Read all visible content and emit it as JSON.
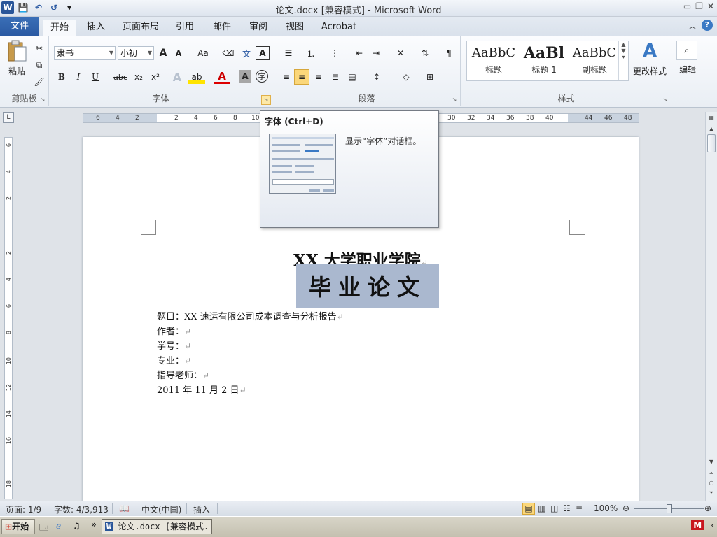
{
  "window": {
    "title": "论文.docx [兼容模式] - Microsoft Word",
    "app_icon_letter": "W"
  },
  "qat": {
    "save": "💾",
    "undo": "↶",
    "redo": "↺",
    "more": "▾"
  },
  "tabs": [
    {
      "label": "文件"
    },
    {
      "label": "开始"
    },
    {
      "label": "插入"
    },
    {
      "label": "页面布局"
    },
    {
      "label": "引用"
    },
    {
      "label": "邮件"
    },
    {
      "label": "审阅"
    },
    {
      "label": "视图"
    },
    {
      "label": "Acrobat"
    }
  ],
  "ribbon": {
    "clipboard": {
      "label": "剪贴板",
      "paste": "粘贴"
    },
    "font": {
      "label": "字体",
      "font_name": "隶书",
      "font_size": "小初",
      "grow": "A",
      "shrink": "A",
      "change_case": "Aa",
      "bold": "B",
      "italic": "I",
      "underline": "U",
      "strike": "abc",
      "subscript": "x₂",
      "superscript": "x²"
    },
    "paragraph": {
      "label": "段落"
    },
    "styles": {
      "label": "样式",
      "items": [
        {
          "sample": "AaBbC",
          "name": "标题"
        },
        {
          "sample": "AaBl",
          "name": "标题 1"
        },
        {
          "sample": "AaBbC",
          "name": "副标题"
        }
      ],
      "change_styles": "更改样式"
    },
    "editing": {
      "label": "编辑"
    }
  },
  "ruler": {
    "ticks": [
      "6",
      "4",
      "2",
      "2",
      "4",
      "6",
      "8",
      "10",
      "30",
      "32",
      "34",
      "36",
      "38",
      "40",
      "44",
      "46",
      "48"
    ],
    "vticks": [
      "6",
      "4",
      "2",
      "2",
      "4",
      "6",
      "8",
      "10",
      "12",
      "14",
      "16",
      "18"
    ]
  },
  "tooltip": {
    "title": "字体 (Ctrl+D)",
    "description": "显示“字体”对话框。"
  },
  "document": {
    "title": "XX 大学职业学院",
    "banner": "毕业论文",
    "lines": [
      "题目：XX 速运有限公司成本调查与分析报告",
      "作者：",
      "学号：",
      "专业：",
      "指导老师：",
      "2011 年 11 月 2 日"
    ],
    "return_mark": "↵"
  },
  "statusbar": {
    "page": "页面: 1/9",
    "words": "字数: 4/3,913",
    "language": "中文(中国)",
    "mode": "插入",
    "zoom": "100%",
    "zoom_fraction": 0.5
  },
  "taskbar": {
    "start": "开始",
    "task": "论文.docx [兼容模式..."
  },
  "colors": {
    "file_tab": "#2a59a2",
    "selection": "#aab8cf",
    "accent": "#3a79c4"
  }
}
